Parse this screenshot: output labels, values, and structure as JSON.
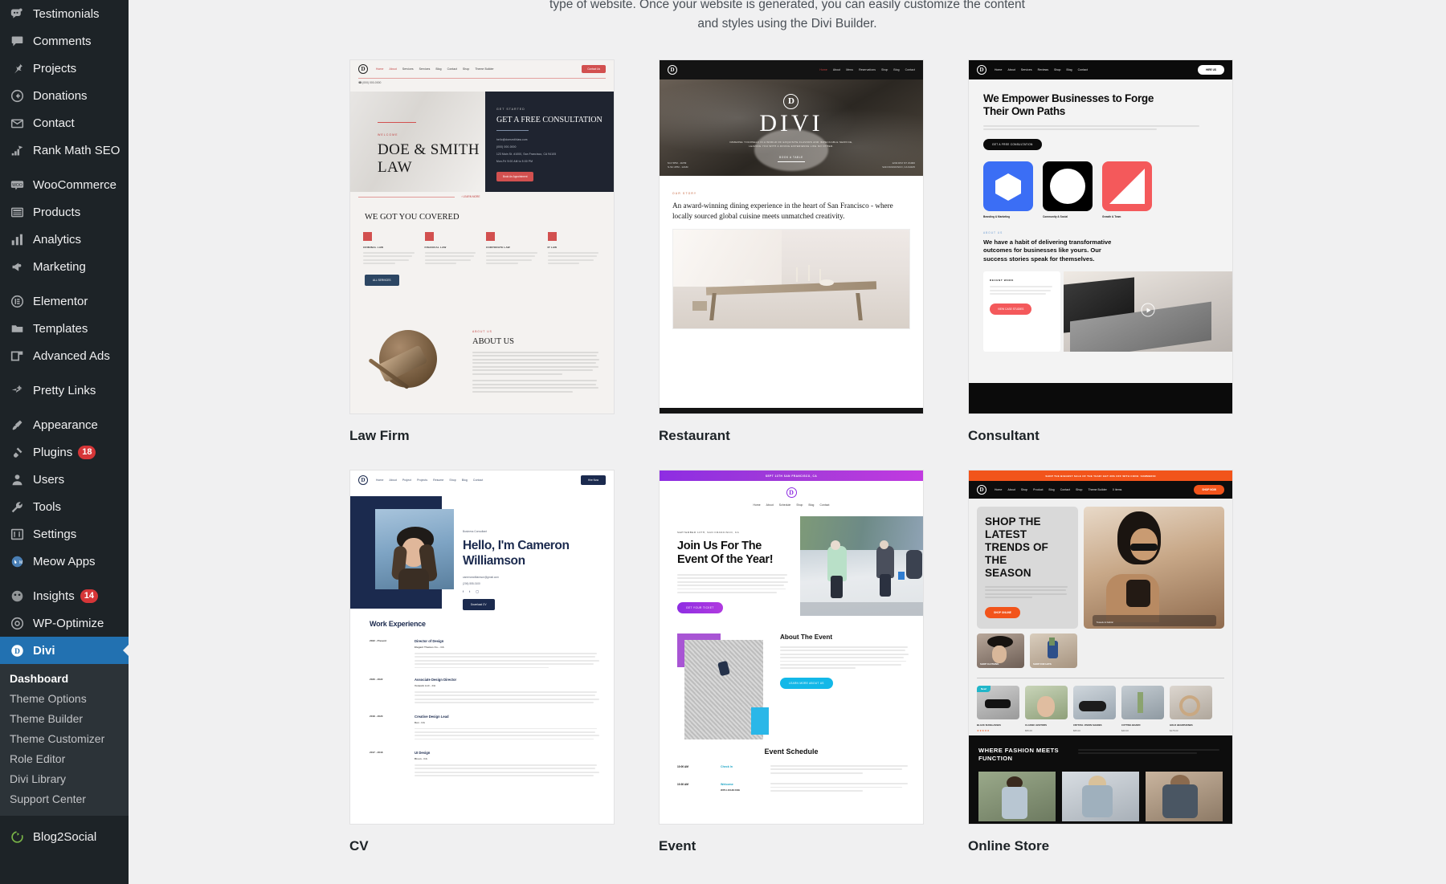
{
  "sidebar": {
    "items": [
      {
        "label": "Testimonials",
        "icon": "testimonials-icon",
        "badge": null,
        "group": 0
      },
      {
        "label": "Comments",
        "icon": "comments-icon",
        "badge": null,
        "group": 0
      },
      {
        "label": "Projects",
        "icon": "pin-icon",
        "badge": null,
        "group": 0
      },
      {
        "label": "Donations",
        "icon": "donations-icon",
        "badge": null,
        "group": 0
      },
      {
        "label": "Contact",
        "icon": "envelope-icon",
        "badge": null,
        "group": 0
      },
      {
        "label": "Rank Math SEO",
        "icon": "rank-math-icon",
        "badge": null,
        "group": 0
      },
      {
        "label": "WooCommerce",
        "icon": "woocommerce-icon",
        "badge": null,
        "group": 1
      },
      {
        "label": "Products",
        "icon": "products-icon",
        "badge": null,
        "group": 1
      },
      {
        "label": "Analytics",
        "icon": "analytics-icon",
        "badge": null,
        "group": 1
      },
      {
        "label": "Marketing",
        "icon": "megaphone-icon",
        "badge": null,
        "group": 1
      },
      {
        "label": "Elementor",
        "icon": "elementor-icon",
        "badge": null,
        "group": 2
      },
      {
        "label": "Templates",
        "icon": "folder-icon",
        "badge": null,
        "group": 2
      },
      {
        "label": "Advanced Ads",
        "icon": "advanced-ads-icon",
        "badge": null,
        "group": 2
      },
      {
        "label": "Pretty Links",
        "icon": "pretty-links-icon",
        "badge": null,
        "group": 3
      },
      {
        "label": "Appearance",
        "icon": "brush-icon",
        "badge": null,
        "group": 4
      },
      {
        "label": "Plugins",
        "icon": "plug-icon",
        "badge": "18",
        "group": 4
      },
      {
        "label": "Users",
        "icon": "user-icon",
        "badge": null,
        "group": 4
      },
      {
        "label": "Tools",
        "icon": "wrench-icon",
        "badge": null,
        "group": 4
      },
      {
        "label": "Settings",
        "icon": "settings-icon",
        "badge": null,
        "group": 4
      },
      {
        "label": "Meow Apps",
        "icon": "meow-apps-icon",
        "badge": null,
        "group": 4
      },
      {
        "label": "Insights",
        "icon": "insights-icon",
        "badge": "14",
        "group": 5
      },
      {
        "label": "WP-Optimize",
        "icon": "wp-optimize-icon",
        "badge": null,
        "group": 5
      }
    ],
    "active": {
      "label": "Divi",
      "icon": "divi-icon"
    },
    "submenu": [
      {
        "label": "Dashboard",
        "current": true
      },
      {
        "label": "Theme Options",
        "current": false
      },
      {
        "label": "Theme Builder",
        "current": false
      },
      {
        "label": "Theme Customizer",
        "current": false
      },
      {
        "label": "Role Editor",
        "current": false
      },
      {
        "label": "Divi Library",
        "current": false
      },
      {
        "label": "Support Center",
        "current": false
      }
    ],
    "after": [
      {
        "label": "Blog2Social",
        "icon": "blog2social-icon",
        "badge": null
      }
    ],
    "colors": {
      "background": "#1d2327",
      "submenu_background": "#2c3338",
      "active_background": "#2271b1",
      "badge": "#d63638",
      "text": "#f0f0f1",
      "icon": "#a7aaad"
    }
  },
  "intro": {
    "line1": "type of website. Once your website is generated, you can easily customize the content",
    "line2": "and styles using the Divi Builder."
  },
  "layouts": [
    {
      "id": "law-firm",
      "label": "Law Firm",
      "nav": [
        "Home",
        "About",
        "Services",
        "Services",
        "Blog",
        "Contact",
        "Shop",
        "Theme Builder"
      ],
      "cta": "Contact Us",
      "phone": "(000) 000-0000",
      "eyebrow": "WELCOME",
      "hero_title": "DOE & SMITH LAW",
      "panel_eyebrow": "GET STARTED",
      "panel_title": "GET A FREE CONSULTATION",
      "panel_lines": [
        "hello@doesmithlaw.com",
        "(000) 000-0000",
        "123 Main St. #1000, San Francisco, CA 94105",
        "Mon-Fri 9:00 AM to 5:00 PM"
      ],
      "panel_button": "Book An Appointment",
      "learn_more": "LEARN MORE",
      "section_title": "WE GOT YOU COVERED",
      "services": [
        "CRIMINAL LAW",
        "FINANCIAL LAW",
        "CORPORATE LAW",
        "IP LAW"
      ],
      "services_button": "ALL SERVICES",
      "about_eyebrow": "ABOUT US",
      "about_title": "ABOUT US"
    },
    {
      "id": "restaurant",
      "label": "Restaurant",
      "nav": [
        "Home",
        "About",
        "Menu",
        "Reservations",
        "Shop",
        "Blog",
        "Contact"
      ],
      "brand": "DIVI",
      "tagline_line1": "IMMERSE YOURSELF IN A WORLD OF EXQUISITE FLAVORS AND IMPECCABLE SERVICE,",
      "tagline_line2": "LEAVING YOU WITH A DINING EXPERIENCE LIKE NO OTHER.",
      "hero_button": "BOOK A TABLE",
      "hours_line1": "M-F 5PM - 11PM",
      "hours_line2": "S-SU 2PM - 12AM",
      "address_line1": "1234 DIVI ST. #1000",
      "address_line2": "SAN FRANCISCO, CA 94105",
      "eyebrow": "OUR STORY",
      "statement": "An award-winning dining experience in the heart of San Francisco - where locally sourced global cuisine meets unmatched creativity."
    },
    {
      "id": "consultant",
      "label": "Consultant",
      "nav": [
        "Home",
        "About",
        "Services",
        "Reviews",
        "Shop",
        "Blog",
        "Contact"
      ],
      "cta": "HIRE US",
      "hero_title": "We Empower Businesses to Forge Their Own Paths",
      "hero_sub": "Unleashing the full potential of your business. Turn your vision into a successful reality by implementing innovative strategies and fostering a culture of growth and excellence.",
      "hero_button": "GET A FREE CONSULTATION",
      "tiles": [
        {
          "label": "Branding & Marketing",
          "color": "#3b6ef5",
          "shape": "hexagon"
        },
        {
          "label": "Community & Social",
          "color": "#000000",
          "shape": "circle"
        },
        {
          "label": "Growth & Team",
          "color": "#f4595b",
          "shape": "triangle"
        }
      ],
      "about_eyebrow": "ABOUT US",
      "about_title": "We have a habit of delivering transformative outcomes for businesses like yours. Our success stories speak for themselves.",
      "card_eyebrow": "RECENT WORK",
      "card_body": "We deliver proven transformative results with relevant strategies, deep industry expertise, and unwavering reliability for your business success.",
      "card_button": "VIEW CASE STUDIES"
    },
    {
      "id": "cv",
      "label": "CV",
      "nav": [
        "Home",
        "About",
        "Project",
        "Projects",
        "Resume",
        "Shop",
        "Blog",
        "Contact"
      ],
      "cta": "Hire Now",
      "eyebrow": "Business Consultant",
      "hero_title": "Hello, I'm Cameron Williamson",
      "email": "cameronwilliamson@gmail.com",
      "phone": "(206) 555-0100",
      "hero_button": "Download CV",
      "section_title": "Work Experience",
      "experience": [
        {
          "years": "2022 - Present",
          "role": "Director of Design",
          "company": "Elegant Themes Co. - CA"
        },
        {
          "years": "2020 - 2022",
          "role": "Associate Design Director",
          "company": "Vorwerk LLC - CA"
        },
        {
          "years": "2018 - 2020",
          "role": "Creative Design Lead",
          "company": "Dev - CA"
        },
        {
          "years": "2017 - 2018",
          "role": "UI Design",
          "company": "Bison - CA"
        }
      ]
    },
    {
      "id": "event",
      "label": "Event",
      "announcement": "SEPT 13TH SAN FRANCISCO, CA",
      "nav": [
        "Home",
        "About",
        "Schedule",
        "Shop",
        "Blog",
        "Contact"
      ],
      "eyebrow": "SEPTEMBER 13TH, SAN FRANCISCO, CA",
      "hero_title": "Join Us For The Event Of the Year!",
      "hero_body": "Get ready to be a part of something extraordinary! Join us for the biggest event of the year and experience a celebration like no other. Be prepared to be amazed, inspired, and delighted. Don't miss out on this unforgettable opportunity to connect, learn, and grow. Mark your calendars and get ready for an event that will leave you speechless.",
      "hero_button": "GET YOUR TICKET",
      "about_title": "About The Event",
      "about_body": "Join us in the vibrant city of San Francisco for our highly anticipated annual meetup event! Connect with like-minded individuals, attend inspiring workshops, and enjoy networking opportunities in the heart of Silicon Valley. Get ready for a weekend full of innovation, learning, and endless possibilities. Mark your calendars and don't miss out on this unforgettable experience!",
      "about_button": "LEARN MORE ABOUT US",
      "schedule_title": "Event Schedule",
      "schedule": [
        {
          "time": "10:00 AM",
          "title": "Check In",
          "sub": "",
          "desc": "Collect your event badge, schedule, and a welcome packet. Grab a coffee, meet fellow attendees, and get ready for an exciting day!"
        },
        {
          "time": "10:30 AM",
          "title": "Welcome",
          "sub": "WITH JOHN DOE",
          "desc": "Our event's hosts will introduce the day's agenda, share important information, and provide an overview of what to expect. It's the perfect way to kick off the day!"
        }
      ]
    },
    {
      "id": "online-store",
      "label": "Online Store",
      "announcement": "SHOP THE BIGGEST SALE OF THE YEAR! GET 30% OFF WITH CODE: SUMMER30",
      "nav": [
        "Home",
        "About",
        "Shop",
        "Product",
        "Blog",
        "Contact",
        "Shop",
        "Theme Builder",
        "0 items"
      ],
      "cta": "SHOP NOW",
      "hero_title": "SHOP THE LATEST TRENDS OF THE SEASON",
      "hero_body": "Elevate your style game with the Latest 2.0 collection! Whether you're relaxing by the pool or strolling the city streets, our clothes and accessories will take your look to new heights.",
      "hero_button": "SHOP ONLINE",
      "tile1": "SHOP CLOTHING",
      "tile2": "SHOP FOR HATS",
      "feature_overlay": "Towels & Fabric",
      "products": [
        {
          "name": "BLACK SUNGLASSES",
          "price": "$45.00",
          "sale": "$32.00",
          "badge": "New!",
          "rating": 5
        },
        {
          "name": "CLASSIC AVIATORS",
          "price": "$55.00",
          "sale": null,
          "badge": null,
          "rating": 0
        },
        {
          "name": "CRYSTAL VISION SHADES",
          "price": "$65.00",
          "sale": null,
          "badge": null,
          "rating": 0
        },
        {
          "name": "CUTTING BOARD",
          "price": "$40.00",
          "sale": null,
          "badge": null,
          "rating": 0
        },
        {
          "name": "GOLD HEADPHONES",
          "price": "$175.00",
          "sale": null,
          "badge": null,
          "rating": 0
        }
      ],
      "banner_title": "WHERE FASHION MEETS FUNCTION",
      "banner_body": "Explore the latest collection of fashion and accessories. Discover a mix of retro-inspired styles and modern designs created to match every individual's unique personality."
    }
  ]
}
